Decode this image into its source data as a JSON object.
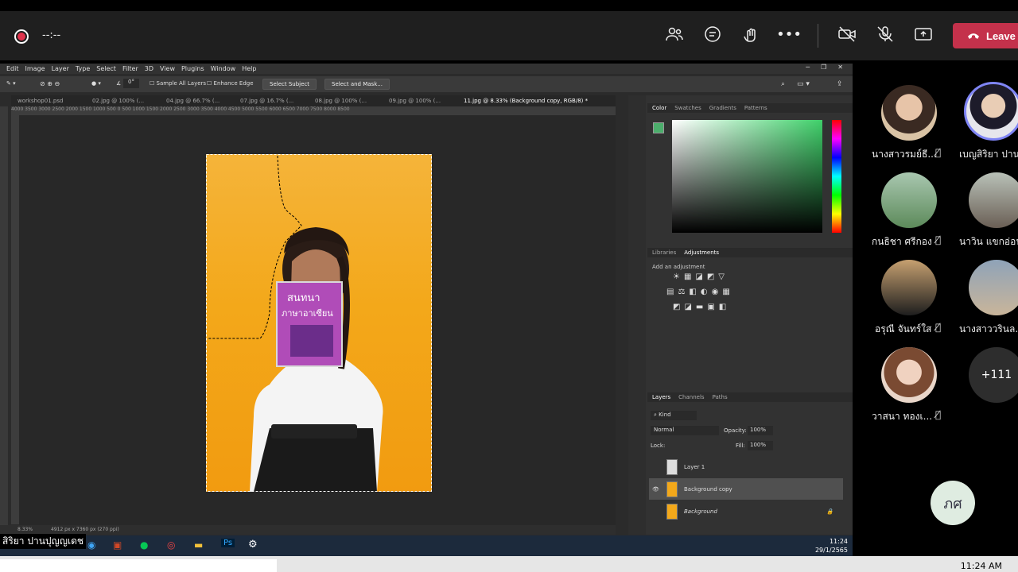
{
  "call": {
    "timer": "--:--",
    "leave_label": "Leave"
  },
  "photoshop": {
    "menu": [
      "Edit",
      "Image",
      "Layer",
      "Type",
      "Select",
      "Filter",
      "3D",
      "View",
      "Plugins",
      "Window",
      "Help"
    ],
    "options": {
      "angle": "0°",
      "sample_all_layers": "Sample All Layers",
      "enhance_edge": "Enhance Edge",
      "select_subject": "Select Subject",
      "select_and_mask": "Select and Mask..."
    },
    "tabs": [
      "workshop01.psd",
      "02.jpg @ 100% (...",
      "04.jpg @ 66.7% (...",
      "07.jpg @ 16.7% (...",
      "08.jpg @ 100% (...",
      "09.jpg @ 100% (...",
      "11.jpg @ 8.33% (Background copy, RGB/8) *"
    ],
    "ruler": "4000  3500  3000  2500  2000  1500  1000  500   0    500  1000  1500  2000  2500  3000  3500  4000  4500  5000  5500  6000  6500  7000  7500  8000  8500",
    "status": {
      "zoom": "8.33%",
      "doc": "4912 px x 7360 px (270 ppi)"
    },
    "book": {
      "title1": "สนทนา",
      "title2": "ภาษาอาเซียน"
    },
    "color_tabs": [
      "Color",
      "Swatches",
      "Gradients",
      "Patterns"
    ],
    "adj_tabs": [
      "Libraries",
      "Adjustments"
    ],
    "add_adjustment": "Add an adjustment",
    "layer_tabs": [
      "Layers",
      "Channels",
      "Paths"
    ],
    "kind": "Kind",
    "blend": "Normal",
    "opacity_label": "Opacity:",
    "opacity": "100%",
    "lock_label": "Lock:",
    "fill_label": "Fill:",
    "fill": "100%",
    "layers": [
      "Layer 1",
      "Background copy",
      "Background"
    ],
    "taskbar_time": "11:24",
    "taskbar_date": "29/1/2565"
  },
  "participants": [
    {
      "name": "นางสาวรมย์ธี..."
    },
    {
      "name": "เบญสิริยา ปานบ"
    },
    {
      "name": "กนธิชา ศรีกอง"
    },
    {
      "name": "นาวิน แขกอ่อน"
    },
    {
      "name": "อรุณี จันทร์ใส"
    },
    {
      "name": "นางสาววรินล..."
    },
    {
      "name": "วาสนา ทองเ..."
    }
  ],
  "more_count": "+111",
  "self_initials": "ภศ",
  "presenter_name": "สิริยา ปานปุญญเดช",
  "win_clock": "11:24 AM",
  "colors": {
    "leave": "#c4314b",
    "photo_bg": "#f3a81a",
    "accent_green": "#4cae6c"
  }
}
